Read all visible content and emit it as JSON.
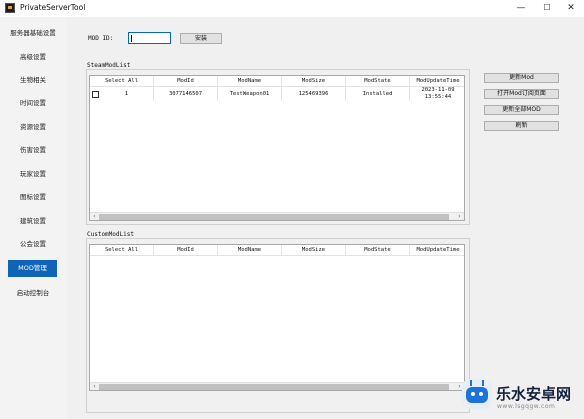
{
  "window": {
    "title": "PrivateServerTool",
    "minimize": "—",
    "maximize": "☐",
    "close": "✕"
  },
  "sidebar": {
    "items": [
      {
        "label": "服务器基础设置",
        "active": false
      },
      {
        "label": "高级设置",
        "active": false
      },
      {
        "label": "生物相关",
        "active": false
      },
      {
        "label": "时间设置",
        "active": false
      },
      {
        "label": "资源设置",
        "active": false
      },
      {
        "label": "伤害设置",
        "active": false
      },
      {
        "label": "玩家设置",
        "active": false
      },
      {
        "label": "图标设置",
        "active": false
      },
      {
        "label": "建筑设置",
        "active": false
      },
      {
        "label": "公会设置",
        "active": false
      },
      {
        "label": "MOD管理",
        "active": true
      },
      {
        "label": "启动控制台",
        "active": false
      }
    ],
    "active_color": "#0f63b8"
  },
  "mod_id": {
    "label": "MOD ID:",
    "value": "",
    "install_label": "安装"
  },
  "steam_list": {
    "title": "SteamModList",
    "columns": [
      "Select All",
      "ModId",
      "ModName",
      "ModSize",
      "ModState",
      "ModUpdateTime"
    ],
    "rows": [
      {
        "selected": false,
        "index": "1",
        "mod_id": "3077146507",
        "mod_name": "TestWeapon01",
        "mod_size": "125469396",
        "mod_state": "Installed",
        "update_time_line1": "2023-11-09",
        "update_time_line2": "13:55:44"
      }
    ]
  },
  "custom_list": {
    "title": "CustomModList",
    "columns": [
      "Select All",
      "ModId",
      "ModName",
      "ModSize",
      "ModState",
      "ModUpdateTime"
    ],
    "rows": []
  },
  "actions": {
    "update_mod": "更新Mod",
    "open_mod_page": "打开Mod订阅页面",
    "update_all": "更新全部MOD",
    "refresh": "刷新"
  },
  "watermark": {
    "text": "乐水安卓网",
    "url": "www.lsgqgw.com"
  }
}
